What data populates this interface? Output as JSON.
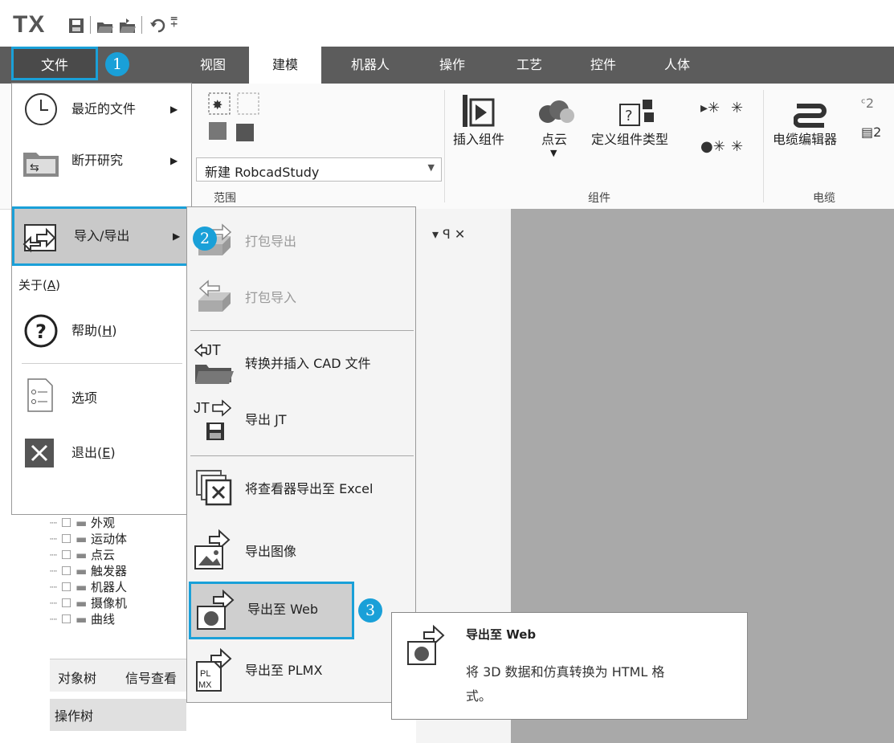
{
  "app": {
    "logo": "TX"
  },
  "quick_access": {
    "items": [
      "save-icon",
      "open-icon",
      "open-folder-icon",
      "undo-icon",
      "customize-icon"
    ],
    "more_glyph": "⩱"
  },
  "tabs": {
    "file": "文件",
    "view": "视图",
    "model": "建模",
    "robot": "机器人",
    "operation": "操作",
    "process": "工艺",
    "control": "控件",
    "human": "人体"
  },
  "ribbon": {
    "study_select_value": "新建 RobcadStudy",
    "group_scope": "范围",
    "insert_component": "插入组件",
    "point_cloud": "点云",
    "define_component_type": "定义组件类型",
    "group_component": "组件",
    "cable_editor": "电缆编辑器",
    "group_cable": "电缆"
  },
  "badges": {
    "one": "1",
    "two": "2",
    "three": "3"
  },
  "file_menu": {
    "recent_files": "最近的文件",
    "disconnect_study": "断开研究",
    "import_export": "导入/导出",
    "about": "关于",
    "about_key": "A",
    "help": "帮助",
    "help_key": "H",
    "options": "选项",
    "exit": "退出",
    "exit_key": "E"
  },
  "submenu": {
    "pack_export": "打包导出",
    "pack_import": "打包导入",
    "convert_insert_cad": "转换并插入 CAD 文件",
    "export_jt": "导出 JT",
    "export_viewer_excel": "将查看器导出至 Excel",
    "export_image": "导出图像",
    "export_web": "导出至 Web",
    "export_plmx": "导出至 PLMX"
  },
  "tooltip": {
    "title": "导出至 Web",
    "body_line1": "将 3D 数据和仿真转换为 HTML 格",
    "body_line2": "式。"
  },
  "panel": {
    "pin_glyph": "▾ ꟼ ✕",
    "tree_items": [
      "外观",
      "运动体",
      "点云",
      "触发器",
      "机器人",
      "摄像机",
      "曲线"
    ],
    "tabs": [
      "对象树",
      "信号查看"
    ],
    "operation_tree": "操作树"
  },
  "colors": {
    "accent": "#1aa0d8",
    "ribbon_tab_bg": "#5c5c5c",
    "viewport": "#a9a9a9"
  }
}
